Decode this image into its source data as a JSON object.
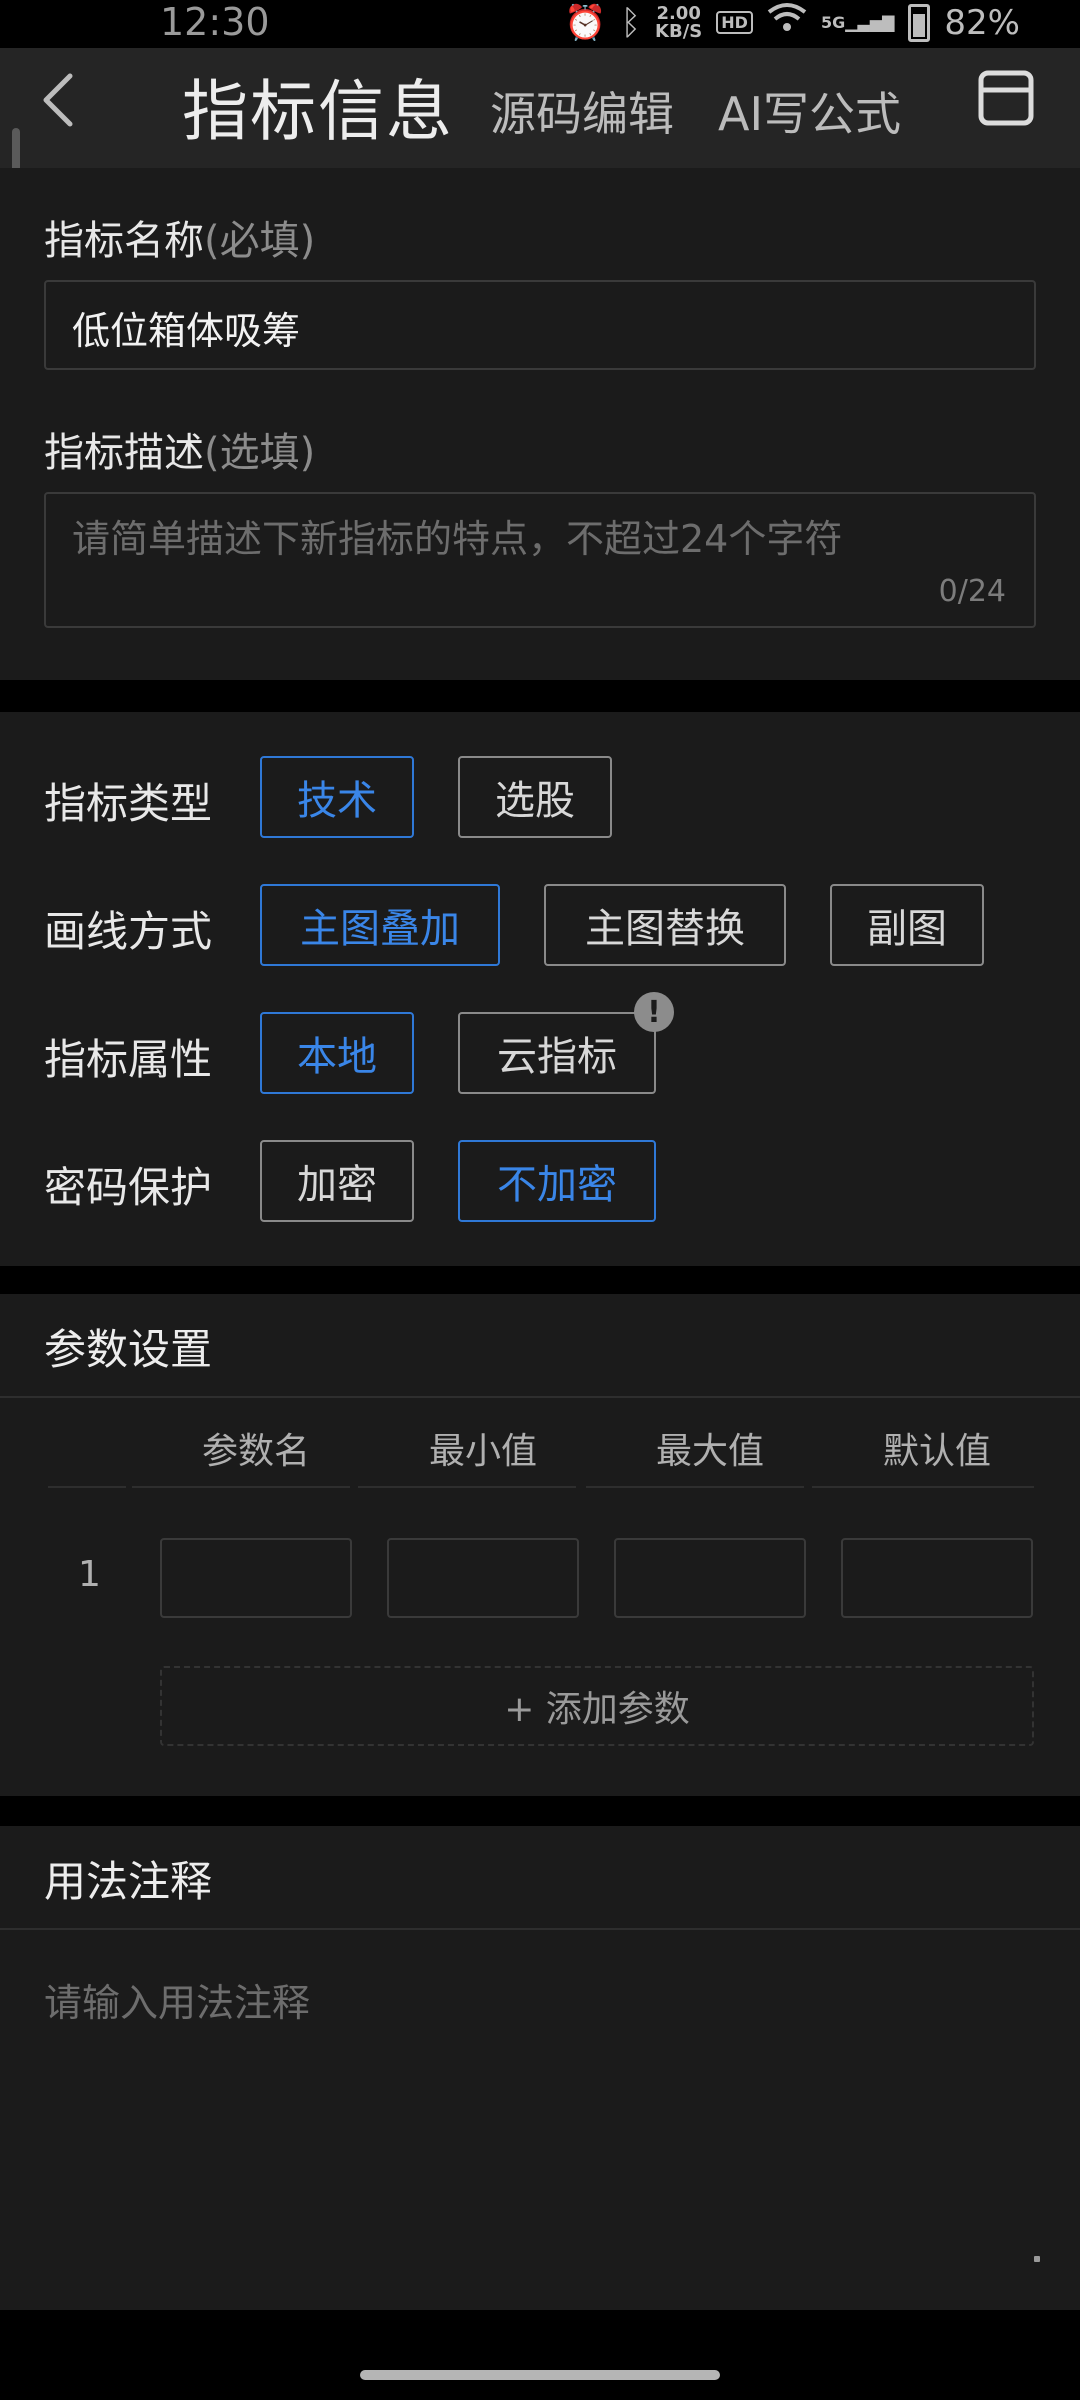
{
  "status": {
    "time": "12:30",
    "speed_value": "2.00",
    "speed_unit": "KB/S",
    "hd": "HD",
    "network": "5G",
    "battery": "82%"
  },
  "nav": {
    "title": "指标信息",
    "source_edit": "源码编辑",
    "ai_formula": "AI写公式"
  },
  "name_field": {
    "label": "指标名称",
    "hint": "(必填)",
    "value": "低位箱体吸筹"
  },
  "desc_field": {
    "label": "指标描述",
    "hint": "(选填)",
    "placeholder": "请简单描述下新指标的特点，不超过24个字符",
    "counter": "0/24"
  },
  "options": {
    "type": {
      "label": "指标类型",
      "choices": [
        "技术",
        "选股"
      ],
      "selected": "技术"
    },
    "draw": {
      "label": "画线方式",
      "choices": [
        "主图叠加",
        "主图替换",
        "副图"
      ],
      "selected": "主图叠加"
    },
    "attr": {
      "label": "指标属性",
      "choices": [
        "本地",
        "云指标"
      ],
      "selected": "本地",
      "badge": "!"
    },
    "password": {
      "label": "密码保护",
      "choices": [
        "加密",
        "不加密"
      ],
      "selected": "不加密"
    }
  },
  "params": {
    "title": "参数设置",
    "columns": [
      "参数名",
      "最小值",
      "最大值",
      "默认值"
    ],
    "rows": [
      {
        "index": "1"
      }
    ],
    "add_button": "+ 添加参数"
  },
  "usage": {
    "title": "用法注释",
    "placeholder": "请输入用法注释"
  },
  "colors": {
    "accent": "#2f78d6",
    "background": "#000000",
    "card": "#1b1b1b"
  }
}
